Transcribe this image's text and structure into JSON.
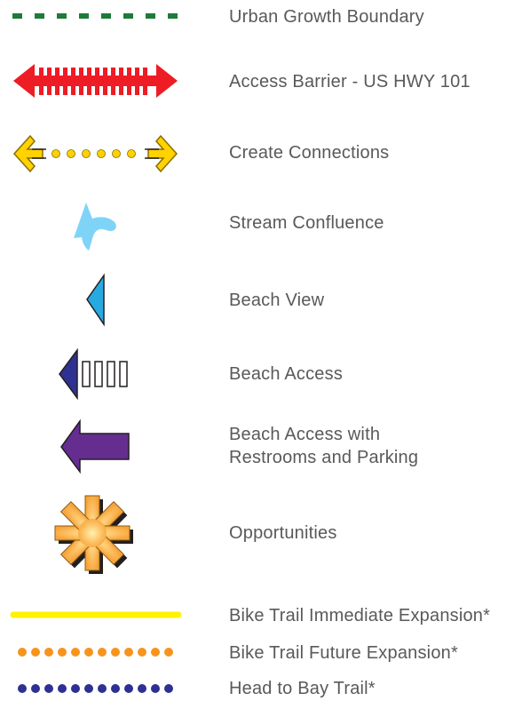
{
  "legend": {
    "items": [
      {
        "label": "Urban Growth Boundary",
        "symbol": "dashed-line-icon",
        "color": "#1e7b3a"
      },
      {
        "label": "Access Barrier - US HWY 101",
        "symbol": "double-arrow-barrier-icon",
        "color": "#ee1c25"
      },
      {
        "label": "Create Connections",
        "symbol": "double-arrow-dotted-icon",
        "color": "#ffd200"
      },
      {
        "label": "Stream Confluence",
        "symbol": "stream-confluence-arrow-icon",
        "color": "#7fd3f7"
      },
      {
        "label": "Beach View",
        "symbol": "beach-view-triangle-icon",
        "color": "#27aae1"
      },
      {
        "label": "Beach Access",
        "symbol": "beach-access-arrow-icon",
        "color": "#2e3192"
      },
      {
        "label_line1": "Beach Access with",
        "label_line2": "Restrooms and Parking",
        "symbol": "beach-access-restrooms-arrow-icon",
        "color": "#662d91"
      },
      {
        "label": "Opportunities",
        "symbol": "opportunities-star-icon",
        "color": "#fbb040"
      },
      {
        "label": "Bike Trail Immediate Expansion*",
        "symbol": "solid-line-icon",
        "color": "#fff200"
      },
      {
        "label": "Bike Trail Future Expansion*",
        "symbol": "orange-dotted-line-icon",
        "color": "#f7941d"
      },
      {
        "label": "Head to Bay Trail*",
        "symbol": "blue-dotted-line-icon",
        "color": "#2e3192"
      }
    ]
  }
}
